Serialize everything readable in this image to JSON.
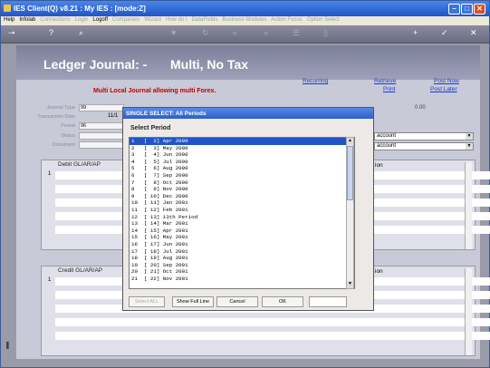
{
  "titlebar": {
    "text": "IES Client(Q) v8.21 : My IES :    [mode:Z]",
    "min": "–",
    "max": "□",
    "close": "✕"
  },
  "menu": [
    {
      "label": "Help",
      "dim": false
    },
    {
      "label": "Infolab",
      "dim": false
    },
    {
      "label": "Connections",
      "dim": true
    },
    {
      "label": "Login",
      "dim": true
    },
    {
      "label": "Logoff",
      "dim": false
    },
    {
      "label": "Companies",
      "dim": true
    },
    {
      "label": "Wizard",
      "dim": true
    },
    {
      "label": "How do I",
      "dim": true
    },
    {
      "label": "DataFields",
      "dim": true
    },
    {
      "label": "Business Modules",
      "dim": true
    },
    {
      "label": "Action Focus",
      "dim": true
    },
    {
      "label": "Option Select",
      "dim": true
    }
  ],
  "header": {
    "title": "Ledger Journal: -",
    "subtitle": "Multi, No Tax"
  },
  "links": {
    "recurring": "Recurring",
    "retrieve": "Retrieve",
    "print": "Print",
    "post_now": "Post Now",
    "post_later": "Post Later"
  },
  "warning": "Multi Local Journal allowing multi Forex.",
  "fields": [
    {
      "label": "Journal Type",
      "value": "99"
    },
    {
      "label": "Transaction Date",
      "value": "11/1"
    },
    {
      "label": "Period",
      "value": "96"
    },
    {
      "label": "Status",
      "value": ""
    },
    {
      "label": "Document",
      "value": ""
    }
  ],
  "right_value": "0.00",
  "selects": [
    "account",
    "account"
  ],
  "debit_header": "Debit GL/AR/AP",
  "credit_header": "Credit GL/AR/AP",
  "col_on": "ion",
  "row_marker": "1",
  "dialog": {
    "title": "SINGLE SELECT: All Periods",
    "subtitle": "Select Period",
    "items": [
      "1   [  2] Apr 2000",
      "2   [  3] May 2000",
      "3   [  4] Jun 2000",
      "4   [  5] Jul 2000",
      "5   [  6] Aug 2000",
      "6   [  7] Sep 2000",
      "7   [  8] Oct 2000",
      "8   [  9] Nov 2000",
      "9   [ 10] Dec 2000",
      "10  [ 11] Jan 2001",
      "11  [ 12] Feb 2001",
      "12  [ 13] 13th Period",
      "13  [ 14] Mar 2001",
      "14  [ 15] Apr 2001",
      "15  [ 16] May 2001",
      "16  [ 17] Jun 2001",
      "17  [ 18] Jul 2001",
      "18  [ 19] Aug 2001",
      "19  [ 20] Sep 2001",
      "20  [ 21] Oct 2001",
      "21  [ 22] Nov 2001"
    ],
    "buttons": {
      "select_all": "Select ALL",
      "show_full": "Show Full Line",
      "cancel": "Cancel",
      "ok": "OK"
    }
  }
}
